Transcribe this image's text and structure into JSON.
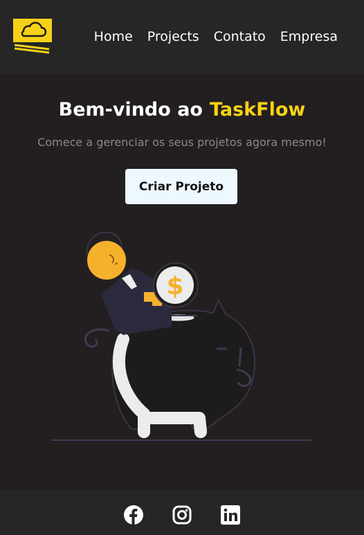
{
  "header": {
    "logo_icon": "cloud-money-icon",
    "nav": [
      {
        "label": "Home"
      },
      {
        "label": "Projects"
      },
      {
        "label": "Contato"
      },
      {
        "label": "Empresa"
      }
    ]
  },
  "hero": {
    "title_prefix": "Bem-vindo ao",
    "title_brand": "TaskFlow",
    "subtitle": "Comece a gerenciar os seus projetos agora mesmo!",
    "cta_label": "Criar Projeto",
    "illustration_symbol": "$"
  },
  "footer": {
    "social_icons": [
      "facebook-icon",
      "instagram-icon",
      "linkedin-icon"
    ]
  },
  "colors": {
    "background": "#231f20",
    "bar": "#262626",
    "accent": "#f7d117",
    "button_bg": "#eef8ff",
    "subtitle": "#8a8a8a"
  }
}
